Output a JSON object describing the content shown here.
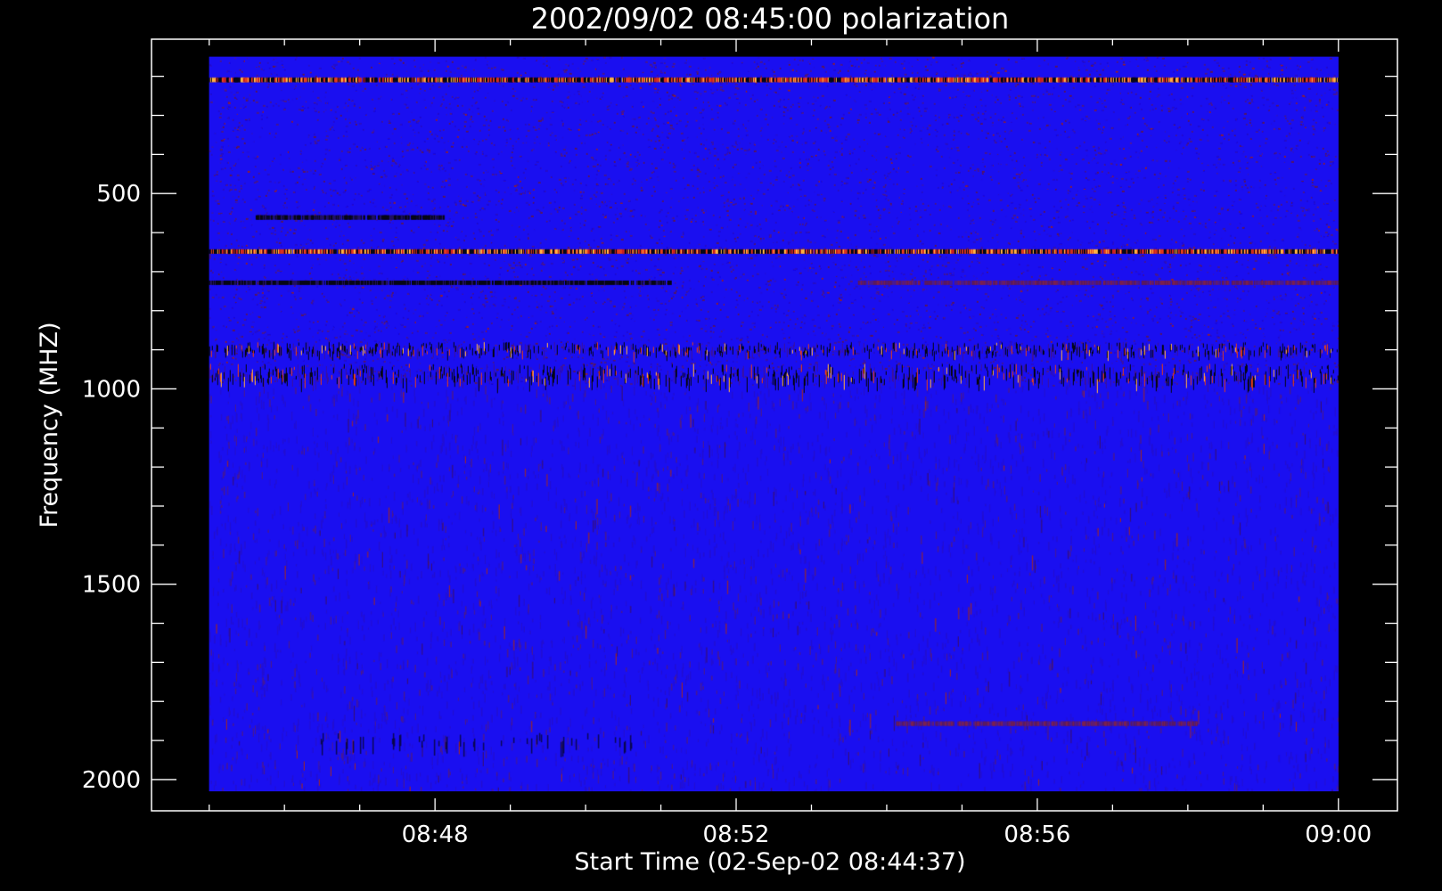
{
  "chart_data": {
    "type": "heatmap",
    "title": "2002/09/02 08:45:00 polarization",
    "xlabel": "Start Time (02-Sep-02 08:44:37)",
    "ylabel": "Frequency (MHZ)",
    "x_tick_labels": [
      "08:48",
      "08:52",
      "08:56",
      "09:00"
    ],
    "x_tick_values_min": [
      3.383,
      7.383,
      11.383,
      15.383
    ],
    "x_minor_tick_step_min": 1,
    "x_data_range_min": [
      0.383,
      15.383
    ],
    "xlim_min": [
      -0.383,
      16.167
    ],
    "y_tick_labels": [
      "500",
      "1000",
      "1500",
      "2000"
    ],
    "y_tick_values_mhz": [
      500,
      1000,
      1500,
      2000
    ],
    "y_minor_tick_step_mhz": 100,
    "y_data_range_mhz": [
      150,
      2030
    ],
    "ylim_mhz": [
      105,
      2080
    ],
    "y_reversed": true,
    "colors": {
      "background": "#000000",
      "axes": "#ffffff",
      "base": "#1a0ff0",
      "noise": "#4a1a90",
      "dark": "#060616",
      "mid": "#e03c1e",
      "hot": "#ffb040",
      "faint": "#5a1a60"
    },
    "features": [
      {
        "kind": "bright_band",
        "freq_mhz": 208,
        "intensity": "high"
      },
      {
        "kind": "bright_band",
        "freq_mhz": 647,
        "intensity": "high"
      },
      {
        "kind": "dark_band",
        "freq_mhz": 727,
        "t_range_min": [
          0.383,
          6.5
        ]
      },
      {
        "kind": "faint_band",
        "freq_mhz": 727,
        "t_range_min": [
          9.0,
          15.383
        ]
      },
      {
        "kind": "dark_band",
        "freq_mhz": 560,
        "t_range_min": [
          1.0,
          3.5
        ]
      },
      {
        "kind": "faint_band",
        "freq_mhz": 1855,
        "t_range_min": [
          9.5,
          13.5
        ]
      },
      {
        "kind": "spiky_band",
        "freq_range_mhz": [
          935,
          975
        ]
      },
      {
        "kind": "spiky_band",
        "freq_range_mhz": [
          880,
          905
        ]
      },
      {
        "kind": "dark_band",
        "freq_range_mhz": [
          1880,
          1930
        ],
        "t_range_min": [
          1.5,
          6.0
        ]
      },
      {
        "kind": "noisy_region",
        "freq_range_mhz": [
          150,
          990
        ]
      },
      {
        "kind": "quiet_region",
        "freq_range_mhz": [
          990,
          2030
        ]
      }
    ]
  }
}
